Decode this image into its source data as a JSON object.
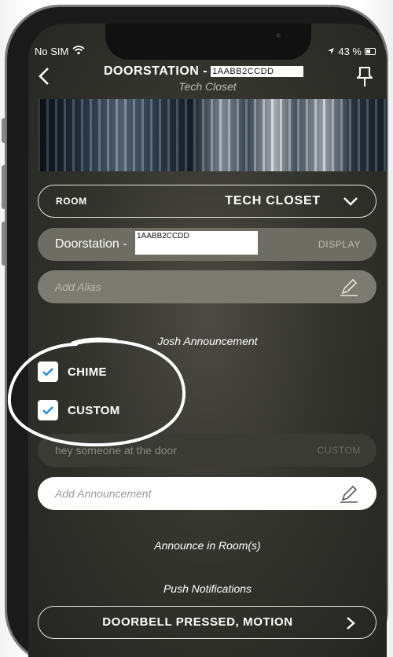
{
  "status_bar": {
    "carrier": "No SIM",
    "battery": "43 %"
  },
  "header": {
    "title": "DOORSTATION -",
    "title_id": "1AABB2CCDD",
    "subtitle": "Tech Closet"
  },
  "room": {
    "label": "ROOM",
    "value": "TECH CLOSET"
  },
  "device": {
    "name_prefix": "Doorstation -",
    "name_id": "1AABB2CCDD",
    "display_label": "DISPLAY"
  },
  "alias": {
    "placeholder": "Add Alias"
  },
  "announcement": {
    "section_title": "Josh Announcement",
    "options": [
      {
        "label": "CHIME",
        "checked": true
      },
      {
        "label": "CUSTOM",
        "checked": true
      }
    ],
    "custom_text": "hey someone at the door",
    "custom_tag": "CUSTOM",
    "add_placeholder": "Add Announcement",
    "announce_rooms_label": "Announce in Room(s)"
  },
  "push": {
    "section_title": "Push Notifications",
    "value": "DOORBELL PRESSED, MOTION"
  },
  "colors": {
    "check_accent": "#2c8cd8",
    "background": "#35352f"
  }
}
